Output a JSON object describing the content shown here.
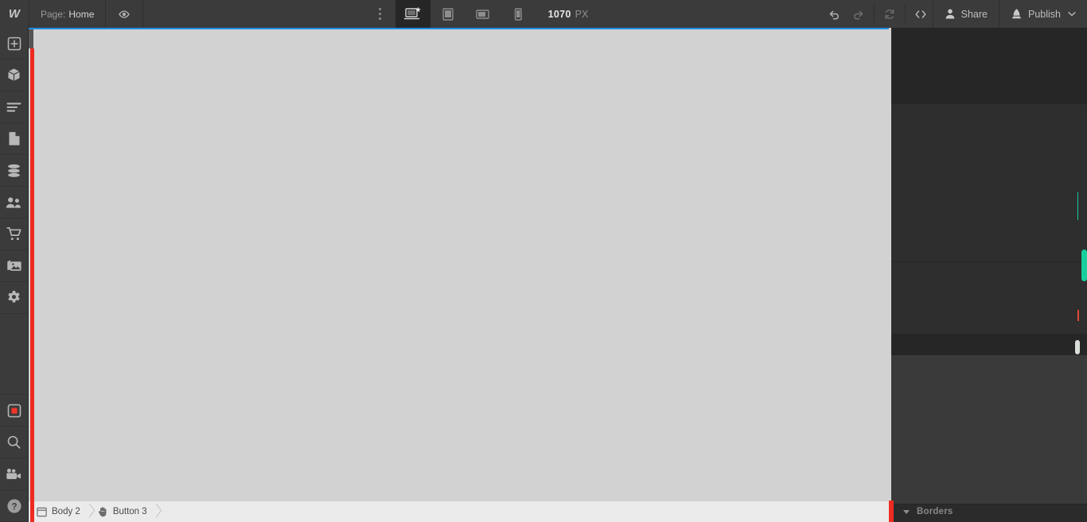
{
  "app": {
    "name": "Webflow Designer",
    "logo_icon": "webflow-logo-icon",
    "logo_glyph": "W"
  },
  "toolbar": {
    "page_label": "Page:",
    "page_value": "Home",
    "preview_icon": "eye-icon",
    "more_menu_icon": "vertical-dots-icon",
    "breakpoints": [
      {
        "id": "desktop",
        "icon": "desktop-star-icon",
        "label": "Desktop",
        "selected": true
      },
      {
        "id": "tablet",
        "icon": "tablet-icon",
        "label": "Tablet",
        "selected": false
      },
      {
        "id": "mobile-landscape",
        "icon": "mobile-landscape-icon",
        "label": "Mobile landscape",
        "selected": false
      },
      {
        "id": "mobile-portrait",
        "icon": "mobile-portrait-icon",
        "label": "Mobile portrait",
        "selected": false
      }
    ],
    "viewport_width": "1070",
    "viewport_unit": "PX",
    "undo_icon": "undo-icon",
    "redo_icon": "redo-icon",
    "refresh_icon": "refresh-icon",
    "code_icon": "code-brackets-icon",
    "share_icon": "person-icon",
    "share_label": "Share",
    "publish_icon": "rocket-icon",
    "publish_label": "Publish",
    "publish_chevron_icon": "chevron-down-icon"
  },
  "sidebar": {
    "items": [
      {
        "id": "add",
        "icon": "plus-square-icon",
        "label": "Add elements"
      },
      {
        "id": "components",
        "icon": "cube-icon",
        "label": "Components"
      },
      {
        "id": "navigator",
        "icon": "layers-lines-icon",
        "label": "Navigator"
      },
      {
        "id": "pages",
        "icon": "page-icon",
        "label": "Pages"
      },
      {
        "id": "cms",
        "icon": "database-icon",
        "label": "CMS"
      },
      {
        "id": "users",
        "icon": "people-icon",
        "label": "Users"
      },
      {
        "id": "ecommerce",
        "icon": "shopping-cart-icon",
        "label": "Ecommerce"
      },
      {
        "id": "assets",
        "icon": "images-icon",
        "label": "Assets"
      },
      {
        "id": "settings",
        "icon": "gear-icon",
        "label": "Settings"
      }
    ],
    "bottom_items": [
      {
        "id": "recording",
        "icon": "red-square-record-icon",
        "label": "Recording"
      },
      {
        "id": "search",
        "icon": "search-icon",
        "label": "Search"
      },
      {
        "id": "video",
        "icon": "video-camera-icon",
        "label": "Video tutorials"
      },
      {
        "id": "help",
        "icon": "question-mark-icon",
        "label": "Help"
      }
    ]
  },
  "canvas": {
    "background_color": "#d2d2d2",
    "selection_outline_color": "#1e90e8",
    "red_guide_color": "#ee2b21"
  },
  "statusbar": {
    "breadcrumbs": [
      {
        "id": "body-2",
        "icon": "body-frame-icon",
        "label": "Body 2"
      },
      {
        "id": "button-3",
        "icon": "hand-icon",
        "label": "Button 3"
      }
    ]
  },
  "right_panel": {
    "section_title": "Borders",
    "collapse_icon": "triangle-down-icon",
    "accent_color": "#17cf9d"
  }
}
